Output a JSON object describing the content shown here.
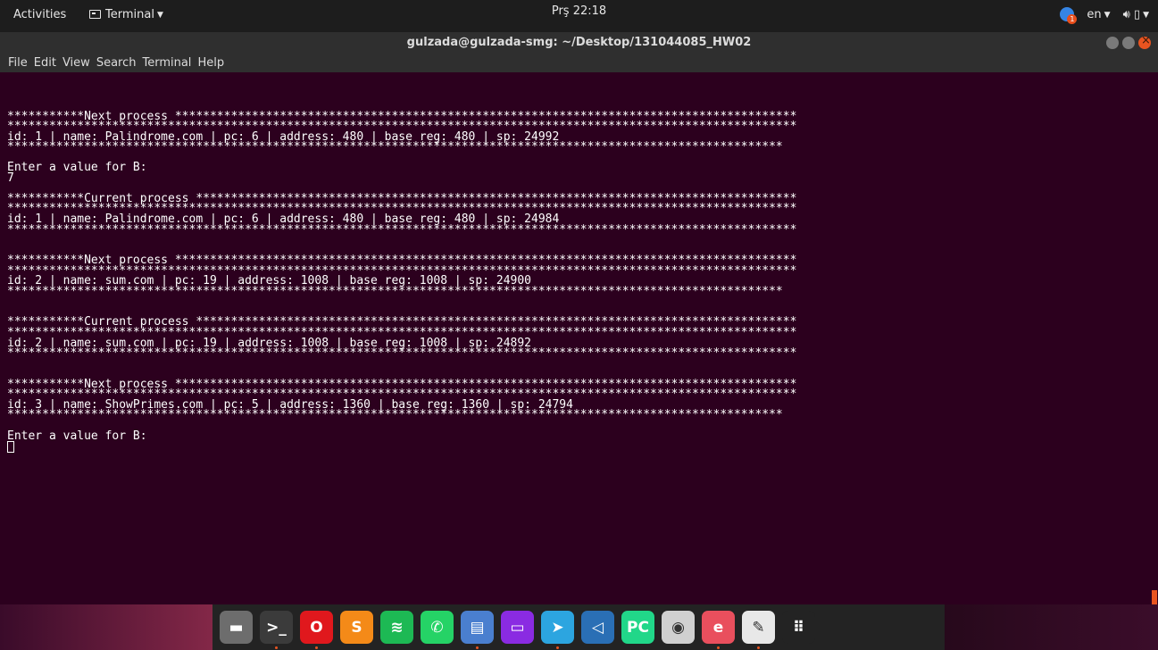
{
  "topbar": {
    "activities": "Activities",
    "app_menu": "Terminal",
    "clock": "Prş 22:18",
    "notification_count": "1",
    "language": "en"
  },
  "window": {
    "title": "gulzada@gulzada-smg: ~/Desktop/131044085_HW02"
  },
  "menubar": {
    "items": [
      "File",
      "Edit",
      "View",
      "Search",
      "Terminal",
      "Help"
    ]
  },
  "terminal": {
    "lines": [
      "",
      "***********Next process *****************************************************************************************",
      "*****************************************************************************************************************",
      "id: 1 | name: Palindrome.com | pc: 6 | address: 480 | base reg: 480 | sp: 24992",
      "***************************************************************************************************************",
      "",
      "Enter a value for B:",
      "7",
      "",
      "***********Current process **************************************************************************************",
      "*****************************************************************************************************************",
      "id: 1 | name: Palindrome.com | pc: 6 | address: 480 | base reg: 480 | sp: 24984",
      "*****************************************************************************************************************",
      "",
      "",
      "***********Next process *****************************************************************************************",
      "*****************************************************************************************************************",
      "id: 2 | name: sum.com | pc: 19 | address: 1008 | base reg: 1008 | sp: 24900",
      "***************************************************************************************************************",
      "",
      "",
      "***********Current process **************************************************************************************",
      "*****************************************************************************************************************",
      "id: 2 | name: sum.com | pc: 19 | address: 1008 | base reg: 1008 | sp: 24892",
      "*****************************************************************************************************************",
      "",
      "",
      "***********Next process *****************************************************************************************",
      "*****************************************************************************************************************",
      "id: 3 | name: ShowPrimes.com | pc: 5 | address: 1360 | base reg: 1360 | sp: 24794",
      "***************************************************************************************************************",
      "",
      "Enter a value for B:"
    ]
  },
  "dock": {
    "apps": [
      {
        "icon": "files-icon",
        "color": "#6d6d6d",
        "running": false
      },
      {
        "icon": "terminal-icon",
        "color": "#3b3b3b",
        "running": true
      },
      {
        "icon": "opera-icon",
        "color": "#e0181d",
        "running": true
      },
      {
        "icon": "sublime-text-icon",
        "color": "#f48a18",
        "running": false
      },
      {
        "icon": "spotify-icon",
        "color": "#1db954",
        "running": false
      },
      {
        "icon": "whatsapp-icon",
        "color": "#25d366",
        "running": false
      },
      {
        "icon": "text-editor-icon",
        "color": "#4a7fcf",
        "running": true
      },
      {
        "icon": "app-icon",
        "color": "#8a2be2",
        "running": false
      },
      {
        "icon": "telegram-icon",
        "color": "#2ca5e0",
        "running": true
      },
      {
        "icon": "vscode-icon",
        "color": "#2a6fb5",
        "running": false
      },
      {
        "icon": "pycharm-icon",
        "color": "#21d789",
        "running": false
      },
      {
        "icon": "camera-icon",
        "color": "#d0d0d0",
        "running": false
      },
      {
        "icon": "edge-icon",
        "color": "#e94f5d",
        "running": true
      },
      {
        "icon": "notes-icon",
        "color": "#e8e8e8",
        "running": true
      },
      {
        "icon": "app-grid-icon",
        "color": "#232323",
        "running": false
      }
    ]
  }
}
